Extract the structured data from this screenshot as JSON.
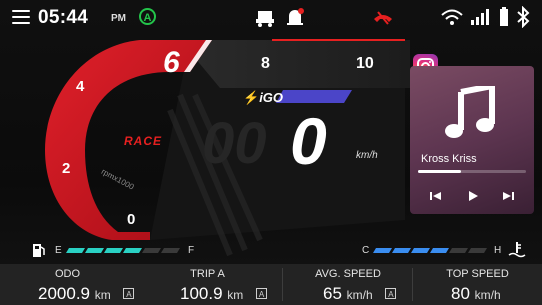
{
  "status_bar": {
    "time": "05:44",
    "ampm": "PM",
    "auto_badge": "A",
    "icons": [
      "menu-icon",
      "vehicle-icon",
      "alert-bell-icon",
      "call-end-icon",
      "wifi-icon",
      "signal-icon",
      "battery-icon",
      "bluetooth-icon"
    ],
    "accent_red": "#e62020",
    "auto_green": "#23c44a"
  },
  "tachometer": {
    "gear": "6",
    "marks": {
      "m0": "0",
      "m2": "2",
      "m4": "4",
      "m8": "8",
      "m10": "10"
    },
    "mode": "RACE",
    "rpm_label": "rpmx1000"
  },
  "speedometer": {
    "brand": "iGO",
    "speed_value": "0",
    "unit": "km/h"
  },
  "media": {
    "song": "Kross Kriss",
    "progress_fraction": 0.4,
    "controls": [
      "previous-icon",
      "play-icon",
      "next-icon"
    ]
  },
  "fuel_gauge": {
    "empty": "E",
    "full": "F",
    "level_fraction": 0.6,
    "bar_color": "#2ad1c4"
  },
  "temp_gauge": {
    "cold": "C",
    "hot": "H",
    "level_fraction": 0.7,
    "bar_color": "#3a8df0"
  },
  "trip_info": {
    "odo": {
      "label": "ODO",
      "value": "2000.9",
      "unit": "km",
      "badge": "A"
    },
    "trip": {
      "label": "TRIP A",
      "value": "100.9",
      "unit": "km",
      "badge": "A"
    },
    "avg": {
      "label": "AVG. SPEED",
      "value": "65",
      "unit": "km/h",
      "badge": "A"
    },
    "top": {
      "label": "TOP SPEED",
      "value": "80",
      "unit": "km/h"
    }
  }
}
